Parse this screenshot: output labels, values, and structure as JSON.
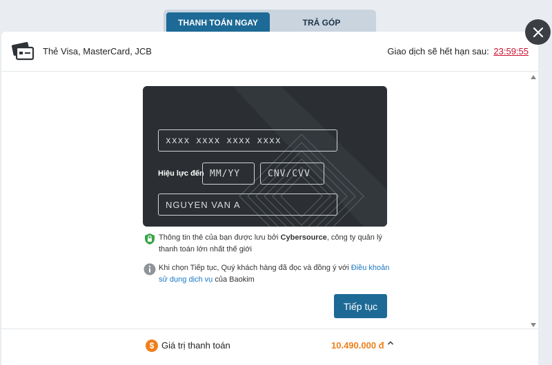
{
  "tabs": [
    {
      "label": "THANH TOÁN NGAY",
      "active": true
    },
    {
      "label": "TRẢ GÓP",
      "active": false
    }
  ],
  "header": {
    "method_label": "Thẻ Visa, MasterCard, JCB",
    "expire_prefix": "Giao dịch sẽ hết hạn sau:",
    "expire_time": "23:59:55"
  },
  "card_form": {
    "number_placeholder": "xxxx xxxx xxxx xxxx",
    "expiry_label": "Hiệu lực đến",
    "expiry_placeholder": "MM/YY",
    "cvv_placeholder": "CNV/CVV",
    "name_placeholder": "NGUYEN VAN A"
  },
  "info": {
    "secure_pre": "Thông tin thẻ của bạn được lưu bởi ",
    "secure_brand": "Cybersource",
    "secure_post": ", công ty quản lý thanh toán lớn nhất thế giới",
    "terms_pre": "Khi chọn Tiếp tục, Quý khách hàng đã đọc và đồng ý với ",
    "terms_link": "Điều khoản sử dụng dịch vụ",
    "terms_post": " của Baokim"
  },
  "continue_label": "Tiếp tục",
  "footer": {
    "total_label": "Giá trị thanh toán",
    "total_value": "10.490.000 đ"
  },
  "colors": {
    "accent": "#1d6a96",
    "expire": "#c8102e",
    "amount": "#f07f1a",
    "card_bg": "#2b2f33"
  },
  "icons": {
    "close": "close-icon",
    "card": "credit-card-icon",
    "secure": "shield-check-icon",
    "info": "info-icon",
    "coin": "dollar-coin-icon",
    "expand": "chevron-up-icon"
  }
}
